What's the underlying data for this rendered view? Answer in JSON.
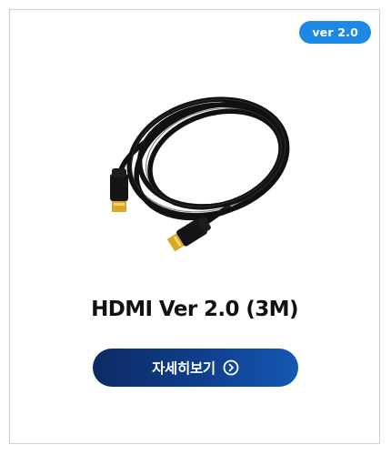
{
  "product": {
    "version_badge": "ver 2.0",
    "title": "HDMI Ver 2.0 (3M)",
    "image_icon": "hdmi-cable-image"
  },
  "actions": {
    "detail_label": "자세히보기",
    "detail_icon": "chevron-right-circle-icon"
  },
  "colors": {
    "badge": "#1e88e5",
    "button_start": "#0d2a63",
    "button_end": "#1459b4",
    "border": "#cfcfcf"
  }
}
